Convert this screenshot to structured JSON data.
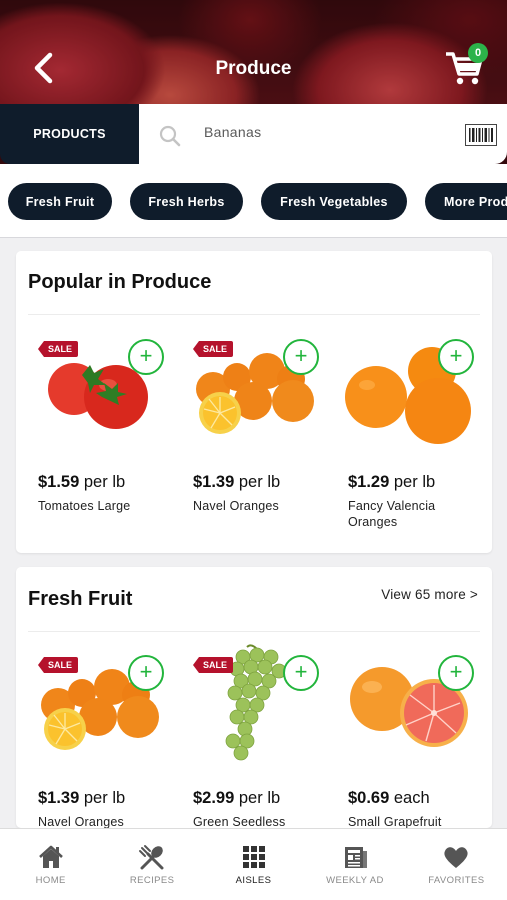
{
  "header": {
    "title": "Produce",
    "cart_count": "0"
  },
  "search": {
    "tab_label": "PRODUCTS",
    "value": "Bananas"
  },
  "chips": [
    "Fresh Fruit",
    "Fresh Herbs",
    "Fresh Vegetables",
    "More Produce"
  ],
  "popular": {
    "title": "Popular in Produce",
    "items": [
      {
        "sale": "SALE",
        "price": "$1.59",
        "unit": " per lb",
        "name": "Tomatoes Large"
      },
      {
        "sale": "SALE",
        "price": "$1.39",
        "unit": " per lb",
        "name": "Navel Oranges"
      },
      {
        "sale": "",
        "price": "$1.29",
        "unit": " per lb",
        "name": "Fancy Valencia Oranges"
      }
    ]
  },
  "fresh_fruit": {
    "title": "Fresh Fruit",
    "view_more": "View 65 more >",
    "items": [
      {
        "sale": "SALE",
        "price": "$1.39",
        "unit": " per lb",
        "name": "Navel Oranges"
      },
      {
        "sale": "SALE",
        "price": "$2.99",
        "unit": " per lb",
        "name": "Green Seedless Grapes"
      },
      {
        "sale": "",
        "price": "$0.69",
        "unit": " each",
        "name": "Small Grapefruit"
      }
    ]
  },
  "nav": [
    {
      "label": "HOME"
    },
    {
      "label": "RECIPES"
    },
    {
      "label": "AISLES"
    },
    {
      "label": "WEEKLY AD"
    },
    {
      "label": "FAVORITES"
    }
  ],
  "colors": {
    "navy": "#0f1c2b",
    "green": "#22b53c",
    "sale_red": "#b5122c"
  }
}
